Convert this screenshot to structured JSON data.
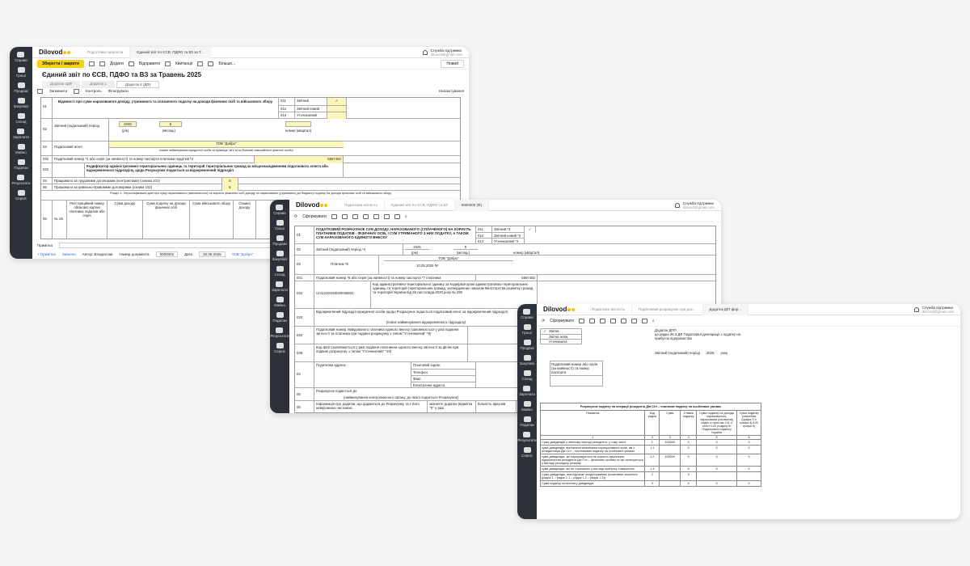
{
  "w1": {
    "logo": "Dilovod",
    "tabs": [
      "Подготовка запросов",
      "Єдиний звіт по ЄСВ, ПДФО та ВЗ за Т..."
    ],
    "user": "Служба підтримки",
    "email": "dilovod@gmail.com",
    "toolbar": {
      "save": "Зберегти і закрити",
      "add": "Додати",
      "send": "Відправити",
      "receipts": "Квитанції",
      "more": "Більше...",
      "new": "Новий"
    },
    "title": "Єдиний звіт по ЄСВ, ПДФО та ВЗ за Травень 2025",
    "subtabs": [
      "Додаток 4ДФ",
      "Додаток 1",
      "Додаток 4 (ДФ)"
    ],
    "actions": {
      "fill": "Заповнити",
      "control": "Контроль",
      "filter": "Фільтрувати",
      "settings": "Налаштування"
    },
    "form": {
      "r01": "01",
      "r01_title": "Відомості про суми нарахованого доходу, утриманого та сплаченого податку на доходи фізичних осіб та військового збору",
      "codes": [
        [
          "011",
          "Звітний"
        ],
        [
          "012",
          "Звітний новий"
        ],
        [
          "013",
          "Уточнюючий"
        ]
      ],
      "check": "✓",
      "r02": "02",
      "r02_label": "Звітний (податковий) період",
      "year": "2025",
      "year_cap": "(рік)",
      "month": "5",
      "month_cap": "(місяць)",
      "quarter_cap": "номер (квартал)",
      "r03": "03",
      "r03_label": "Податковий агент",
      "agent": "ТОВ \"Добро\"",
      "agent_cap": "(повне найменування юридичної особи чи прізвище, ім'я та по батькові самозайнятої фізичної особи)",
      "r031": "031",
      "r031_label": "Податковий номер *1 або серія (за наявності) та номер паспорта платника податків *2",
      "tax_no": "5567482",
      "r032": "032",
      "r032_label": "Кодифікатор адміністративно-територіальних одиниць та територій територіальних громад за місцезнаходженням податкового агента або відокремленого підрозділу, щодо Розрахунок подається за відокремлений підрозділ",
      "r04": "04",
      "r04_label": "Працювало за трудовими договорами (контрактами) (ознака 101)",
      "r04_val": "5",
      "r05": "05",
      "r05_label": "Працювало за цивільно-правовими договорами (ознака 102)",
      "r05_val": "5",
      "section1": "Розділ 1. Персоніфіковані дані про суму нарахованого (виплаченого) на користь фізичних осіб доходу та нарахованих (утриманих) до бюджету податку на доходи фізичних осіб та військового збору",
      "r06": "06",
      "no": "№ з/п",
      "cols": [
        "Реєстраційний номер облікової картки платника податків або серія",
        "Сума доходу",
        "Сума податку на доходи фізичних осіб",
        "Сума військового збору",
        "Ознака доходу",
        "Дата"
      ]
    },
    "footer": {
      "note": "Примітка",
      "add_note": "+ Примітка",
      "changed": "Змінено",
      "author": "Автор: Владислав",
      "docnum_lbl": "Номер документа",
      "docnum": "0000001",
      "date_lbl": "Дата",
      "date": "30.05.2025",
      "org": "ТОВ \"Добро\""
    }
  },
  "w2": {
    "logo": "Dilovod",
    "tabs": [
      "Податкова звітність",
      "Єдиний звіт по ЄСВ, ПДФО та ВЗ",
      "0000000 (Ф)"
    ],
    "user": "Служба підтримки",
    "email": "dilovod@gmail.com",
    "action": "Сформувати",
    "form": {
      "r01": "01",
      "title": "ПОДАТКОВИЙ РОЗРАХУНОК СУМ ДОХОДУ, НАРАХОВАНОГО (СПЛАЧЕНОГО) НА КОРИСТЬ ПЛАТНИКІВ ПОДАТКІВ - ФІЗИЧНИХ ОСІБ, І СУМ УТРИМАНОГО З НИХ ПОДАТКУ, А ТАКОЖ СУМ НАРАХОВАНОГО ЄДИНОГО ВНЕСКУ",
      "codes": [
        [
          "011",
          "Звітний *3"
        ],
        [
          "012",
          "Звітний новий *2"
        ],
        [
          "013",
          "Уточнюючий *3"
        ]
      ],
      "check": "✓",
      "r02": "02",
      "r02_label": "Звітний (податковий) період *4",
      "year": "2025",
      "month": "5",
      "year_cap": "(рік)",
      "month_cap": "(місяць)",
      "quarter_cap": "номер (квартал)",
      "r03": "03",
      "r03_label": "Платник *5",
      "agent": "ТОВ \"Добро\"",
      "date_line": "10.05.2025 Nº",
      "r031": "031",
      "r031_label": "Податковий номер *6 або серія (за наявності) та номер паспорта *7 платника",
      "tax_no": "5567482",
      "r032": "032",
      "koatuu": "UA32100150020045831",
      "r032_label": "Код адміністративно-територіальної одиниці за Кодифікатором адміністративно-територіальних одиниць та територій територіальних громад, затверджених наказом Міністерства розвитку громад та територій України від 26 листопада 2020 року № 290",
      "r033": "033",
      "r033_label": "Відокремлений підрозділ юридичної особи (щодо Розрахунок подається податковий агент за відокремлений підрозділ)",
      "r033_cap": "(повне найменування відокремленого підрозділу)",
      "r034": "034",
      "r034_label": "Податковий номер ліквідованого платника єдиного внеску (заповнюється у разі подання звітності за платника при поданні розрахунку з типом \"Уточнюючий\" *8)",
      "r035": "035",
      "r035_label": "Код філії (заповнюється у разі подання платником єдиного внеску звітності за філію при поданні розрахунку з типом \"Уточнюючий\" *10)",
      "r04": "04",
      "addr": "Податкова адреса",
      "zip": "Поштовий індекс",
      "phone": "Телефон",
      "fax": "Факс",
      "email_lbl": "Електронна адреса",
      "r05": "05",
      "r05_label": "Розрахунок подається до",
      "r05_cap": "(найменування контролюючого органу, до якого подається Розрахунок)",
      "r06": "06",
      "r06_label": "Інформація про додатки, що додаються до Розрахунку та є його невід'ємною частиною",
      "r06_mark": "зазначте додатки (відмітка \"Х\" у разі",
      "r06_cnt": "Кількість аркушів"
    }
  },
  "w3": {
    "logo": "Dilovod",
    "tabs": [
      "Податкова звітність",
      "Податковий розрахунок сум дох...",
      "Додаток Д/П фор..."
    ],
    "user": "Служба підтримки",
    "email": "dilovod@gmail.com",
    "action": "Сформувати",
    "form": {
      "codes": [
        "Звітна",
        "Звітна нова",
        "Уточнююча"
      ],
      "check": "✓",
      "annex": "Додаток ДПП",
      "annex_sub": "до рядка 06.3 ДФ Податкової декларації з податку на прибуток підприємства",
      "period": "Звітний (податковий) період",
      "year": "2025",
      "year_cap": "року",
      "taxno": "Податковий номер або серія (за наявності) та номер паспорта",
      "table_title": "Розрахунок податку на операції резидента Дія Сіті – платника податку на особливих умовах",
      "cols": [
        "Показник",
        "Код рядка",
        "Сума",
        "Ставка податку",
        "Сума податку на доходи нарахованого, нарахована (сплачена) згідно з пунктом 141.4 статті 141 розділу III Податкового кодексу України",
        "Сума податку (значення (графа 3 х графа 4)/100 графа 5)"
      ],
      "nums": [
        "1",
        "2",
        "3",
        "4",
        "5",
        "6"
      ],
      "rows": [
        [
          "Сума дивідендів у звітному періоді резидента, у тому числі",
          "1",
          "100000",
          "Х",
          "Х",
          "Х"
        ],
        [
          "сума дивідендів, виплачена власникам корпоративних прав, які є резидентами Дія Сіті – платниками податку на особливих умовах",
          "1.1",
          "",
          "Х",
          "Х",
          "Х"
        ],
        [
          "сума дивідендів, які нараховуються на користь акціонерів підприємства резидента Дія Сіті – фізичним особам та які сплачуються у вигляді розподілу резерву",
          "1.2",
          "100000",
          "Х",
          "Х",
          "Х"
        ],
        [
          "сума дивідендів, які не отримують у вигляді прибутку товариства",
          "1.3",
          "",
          "Х",
          "Х",
          "Х"
        ],
        [
          "Сума дивідендів, яка підлягає оподаткуванню (позитивне значення (рядок 1 – рядок 1.1 – рядок 1.2 – рядок 1.3))",
          "2",
          "",
          "9",
          "",
          " "
        ],
        [
          "Сума податку на виплату дивідендів",
          "3",
          "",
          "Х",
          "Х",
          "Х"
        ]
      ]
    }
  }
}
